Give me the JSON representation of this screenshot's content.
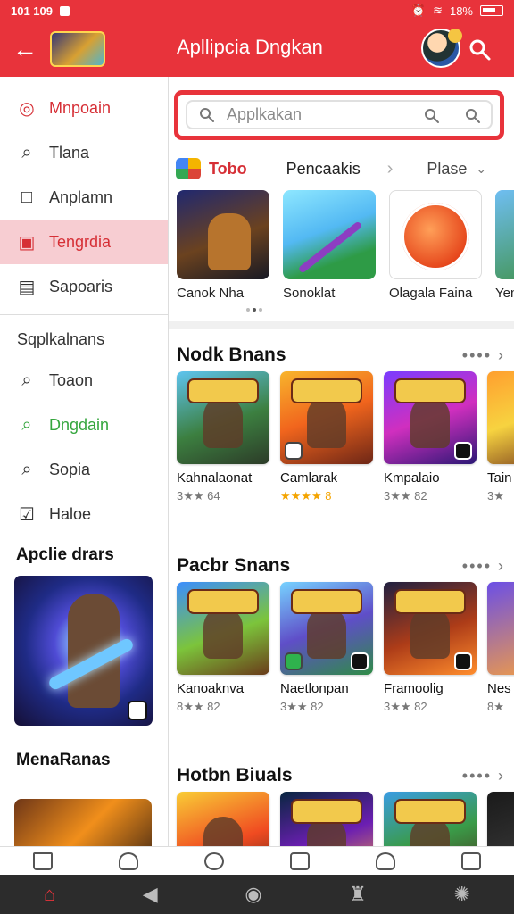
{
  "status": {
    "time": "101 109",
    "battery": "18%"
  },
  "app": {
    "title": "Apllipcia Dngkan"
  },
  "search": {
    "placeholder": "Applkakan"
  },
  "sidebar": {
    "items": [
      {
        "label": "Mnpoain"
      },
      {
        "label": "Tlana"
      },
      {
        "label": "Anplamn"
      },
      {
        "label": "Tengrdia"
      },
      {
        "label": "Sapoaris"
      }
    ],
    "header": "Sqplkalnans",
    "more_items": [
      {
        "label": "Toaon"
      },
      {
        "label": "Dngdain"
      },
      {
        "label": "Sopia"
      },
      {
        "label": "Haloe"
      }
    ],
    "section_1": "Apclie drars",
    "section_2": "MenaRanas"
  },
  "categories": {
    "top": "Tobo",
    "pencil": "Pencaakis",
    "place": "Plase"
  },
  "top_apps": [
    {
      "label": "Canok Nha"
    },
    {
      "label": "Sonoklat"
    },
    {
      "label": "Olagala Faina"
    },
    {
      "label": "Yen"
    }
  ],
  "sections": [
    {
      "title": "Nodk Bnans",
      "cards": [
        {
          "name": "Kahnalaonat",
          "rating": "3★★ 64"
        },
        {
          "name": "Camlarak",
          "rating": "★★★★ 8"
        },
        {
          "name": "Kmpalaio",
          "rating": "3★★ 82"
        },
        {
          "name": "Tain",
          "rating": "3★"
        }
      ]
    },
    {
      "title": "Pacbr Snans",
      "cards": [
        {
          "name": "Kanoaknva",
          "rating": "8★★ 82"
        },
        {
          "name": "Naetlonpan",
          "rating": "3★★ 82"
        },
        {
          "name": "Framoolig",
          "rating": "3★★ 82"
        },
        {
          "name": "Nes",
          "rating": "8★"
        }
      ]
    },
    {
      "title": "Hotbn Biuals",
      "cards": [
        {
          "name": ""
        },
        {
          "name": ""
        },
        {
          "name": ""
        },
        {
          "name": ""
        }
      ]
    }
  ],
  "colors": {
    "accent": "#e8333b",
    "active": "#f7cdd2",
    "green": "#35a63e"
  },
  "icons": {
    "back": "back-arrow-icon",
    "search": "search-icon",
    "more": "more-icon"
  }
}
